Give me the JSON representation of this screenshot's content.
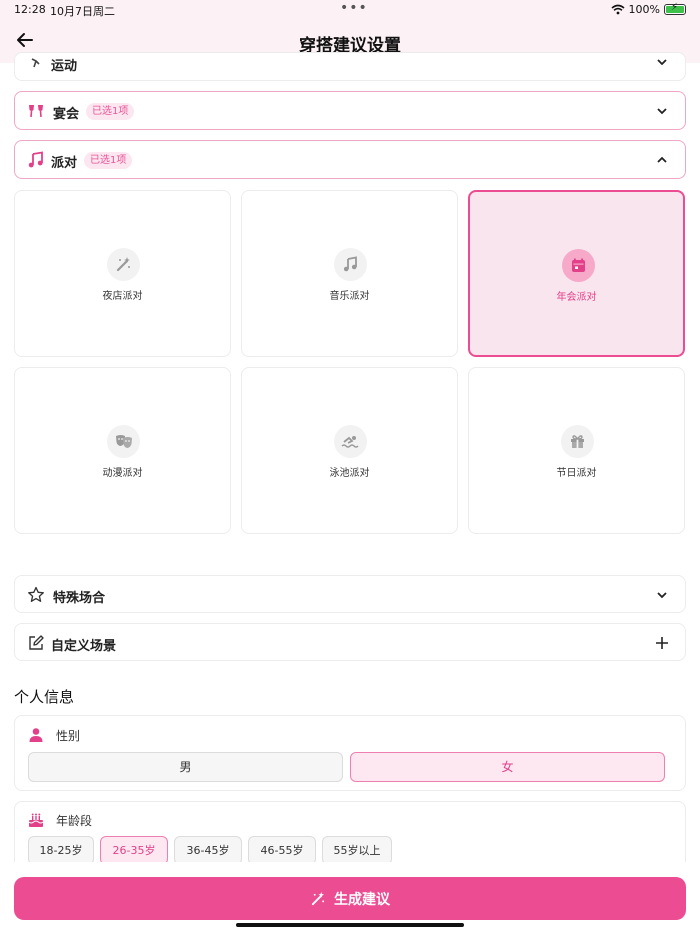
{
  "status": {
    "time": "12:28",
    "date": "10月7日周二",
    "dots": "•••",
    "battery": "100%"
  },
  "header": {
    "title": "穿搭建议设置"
  },
  "categories": [
    {
      "label": "运动",
      "expanded": false
    },
    {
      "label": "宴会",
      "badge": "已选1项",
      "expanded": false
    },
    {
      "label": "派对",
      "badge": "已选1项",
      "expanded": true
    }
  ],
  "party_options": [
    {
      "label": "夜店派对",
      "icon": "magic-wand-icon",
      "selected": false
    },
    {
      "label": "音乐派对",
      "icon": "music-note-icon",
      "selected": false
    },
    {
      "label": "年会派对",
      "icon": "calendar-icon",
      "selected": true
    },
    {
      "label": "动漫派对",
      "icon": "theater-masks-icon",
      "selected": false
    },
    {
      "label": "泳池派对",
      "icon": "swimmer-icon",
      "selected": false
    },
    {
      "label": "节日派对",
      "icon": "gift-icon",
      "selected": false
    }
  ],
  "special": {
    "label": "特殊场合"
  },
  "custom": {
    "label": "自定义场景"
  },
  "personal": {
    "title": "个人信息",
    "gender": {
      "label": "性别",
      "options": [
        "男",
        "女"
      ],
      "selected": "女"
    },
    "age": {
      "label": "年龄段",
      "options": [
        "18-25岁",
        "26-35岁",
        "36-45岁",
        "46-55岁",
        "55岁以上"
      ],
      "selected": "26-35岁"
    }
  },
  "cta": {
    "label": "生成建议"
  },
  "colors": {
    "accent": "#ec4c92",
    "accent_light": "#fce6ef",
    "header_bg": "#fcf1f5"
  }
}
